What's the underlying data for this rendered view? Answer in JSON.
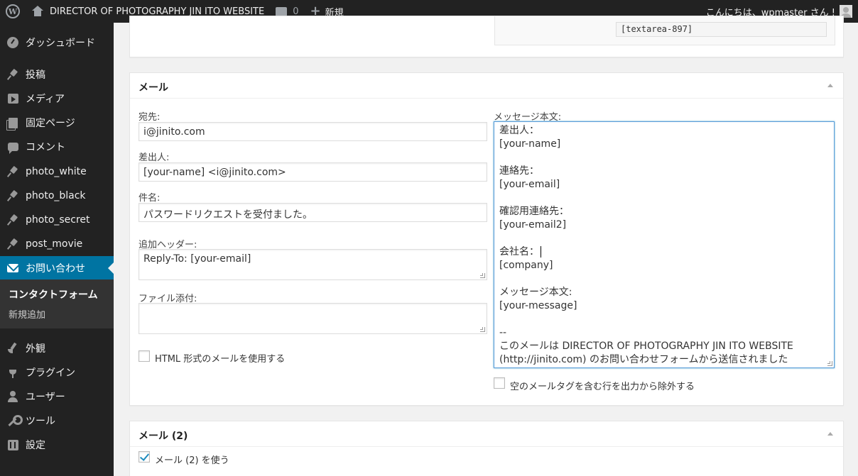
{
  "adminbar": {
    "site_title": "DIRECTOR OF PHOTOGRAPHY JIN ITO WEBSITE",
    "comments_count": "0",
    "new_label": "新規",
    "greeting": "こんにちは、wpmaster さん !"
  },
  "sidebar": {
    "items": [
      {
        "label": "ダッシュボード",
        "icon": "dashboard-icon"
      },
      {
        "label": "投稿",
        "icon": "pin-icon"
      },
      {
        "label": "メディア",
        "icon": "media-icon"
      },
      {
        "label": "固定ページ",
        "icon": "page-icon"
      },
      {
        "label": "コメント",
        "icon": "comment-icon"
      },
      {
        "label": "photo_white",
        "icon": "pin-icon"
      },
      {
        "label": "photo_black",
        "icon": "pin-icon"
      },
      {
        "label": "photo_secret",
        "icon": "pin-icon"
      },
      {
        "label": "post_movie",
        "icon": "pin-icon"
      },
      {
        "label": "お問い合わせ",
        "icon": "mail-icon"
      },
      {
        "label": "外観",
        "icon": "brush-icon"
      },
      {
        "label": "プラグイン",
        "icon": "plugin-icon"
      },
      {
        "label": "ユーザー",
        "icon": "user-icon"
      },
      {
        "label": "ツール",
        "icon": "wrench-icon"
      },
      {
        "label": "設定",
        "icon": "settings-icon"
      }
    ],
    "submenu": {
      "active": "コンタクトフォーム",
      "add_new": "新規追加"
    }
  },
  "top_panel": {
    "tag": "[textarea-897]"
  },
  "mail": {
    "title": "メール",
    "to_label": "宛先:",
    "to_value": "i@jinito.com",
    "from_label": "差出人:",
    "from_value": "[your-name] <i@jinito.com>",
    "subject_label": "件名:",
    "subject_value": "パスワードリクエストを受付ました。",
    "headers_label": "追加ヘッダー:",
    "headers_value": "Reply-To: [your-email]",
    "attachments_label": "ファイル添付:",
    "attachments_value": "",
    "html_checkbox_label": "HTML 形式のメールを使用する",
    "body_label": "メッセージ本文:",
    "body_lines": [
      "差出人：",
      "[your-name]",
      "",
      "連絡先：",
      "[your-email]",
      "",
      "確認用連絡先：",
      "[your-email2]",
      "",
      "会社名：",
      "[company]",
      "",
      "メッセージ本文:",
      "[your-message]",
      "",
      "--",
      "このメールは DIRECTOR OF  PHOTOGRAPHY JIN ITO WEBSITE",
      "(http://jinito.com) のお問い合わせフォームから送信されました"
    ],
    "exclude_blank_label": "空のメールタグを含む行を出力から除外する"
  },
  "mail2": {
    "title": "メール (2)",
    "use_label": "メール (2) を使う"
  }
}
